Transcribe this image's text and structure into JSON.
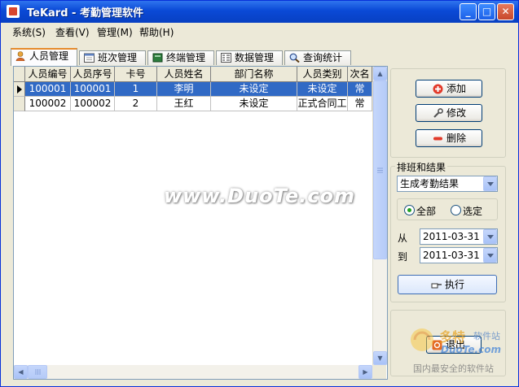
{
  "window": {
    "title": "TeKard - 考勤管理软件"
  },
  "menu": [
    {
      "label": "系统(S)"
    },
    {
      "label": "查看(V)"
    },
    {
      "label": "管理(M)"
    },
    {
      "label": "帮助(H)"
    }
  ],
  "tabs": [
    {
      "label": "人员管理",
      "active": true,
      "icon": "person-icon"
    },
    {
      "label": "班次管理",
      "icon": "calendar-icon"
    },
    {
      "label": "终端管理",
      "icon": "book-icon"
    },
    {
      "label": "数据管理",
      "icon": "database-icon"
    },
    {
      "label": "查询统计",
      "icon": "magnifier-icon"
    }
  ],
  "grid": {
    "columns": [
      "人员编号",
      "人员序号",
      "卡号",
      "人员姓名",
      "部门名称",
      "人员类别",
      "次名"
    ],
    "rows": [
      [
        "100001",
        "100001",
        "1",
        "李明",
        "未设定",
        "未设定",
        "常"
      ],
      [
        "100002",
        "100002",
        "2",
        "王红",
        "未设定",
        "正式合同工",
        "常"
      ]
    ]
  },
  "actions": {
    "add": "添加",
    "edit": "修改",
    "delete": "删除"
  },
  "schedule": {
    "group_title": "排班和结果",
    "mode": "生成考勤结果",
    "radio_all": "全部",
    "radio_selected": "选定",
    "from_label": "从",
    "to_label": "到",
    "from_date": "2011-03-31",
    "to_date": "2011-03-31",
    "execute": "执行"
  },
  "exit_label": "退出",
  "watermarks": {
    "center": "www.DuoTe.com",
    "logo_cn": "多特",
    "logo_sub": "软件站",
    "logo_url": "DuoTe.com",
    "slogan": "国内最安全的软件站"
  },
  "colors": {
    "title_bar": "#0a49d6",
    "selection": "#316ac5",
    "tab_highlight": "#e68b2c"
  }
}
